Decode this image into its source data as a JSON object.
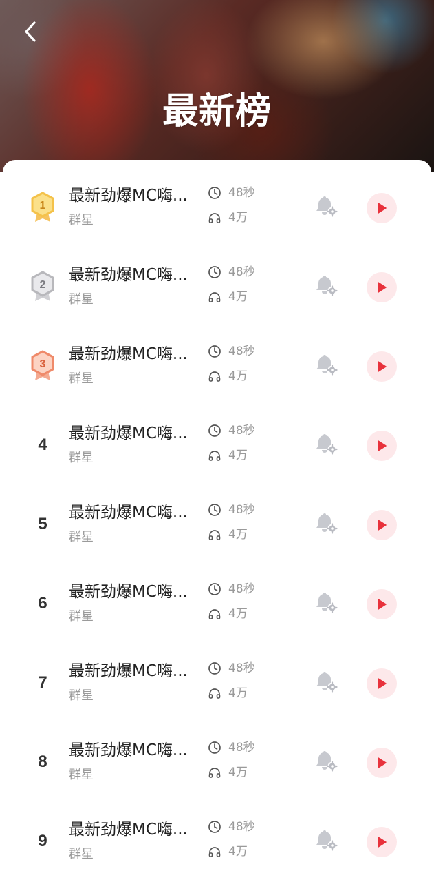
{
  "header": {
    "title": "最新榜",
    "back_icon": "chevron-left-icon"
  },
  "colors": {
    "accent": "#e8323c",
    "play_bg": "#fde8ea",
    "gold": "#f4c24a",
    "silver": "#b8b8bc",
    "bronze": "#ef8a6a"
  },
  "songs": [
    {
      "rank": "1",
      "medal": "gold",
      "title": "最新劲爆MC嗨...",
      "artist": "群星",
      "duration": "48秒",
      "plays": "4万"
    },
    {
      "rank": "2",
      "medal": "silver",
      "title": "最新劲爆MC嗨...",
      "artist": "群星",
      "duration": "48秒",
      "plays": "4万"
    },
    {
      "rank": "3",
      "medal": "bronze",
      "title": "最新劲爆MC嗨...",
      "artist": "群星",
      "duration": "48秒",
      "plays": "4万"
    },
    {
      "rank": "4",
      "medal": "",
      "title": "最新劲爆MC嗨...",
      "artist": "群星",
      "duration": "48秒",
      "plays": "4万"
    },
    {
      "rank": "5",
      "medal": "",
      "title": "最新劲爆MC嗨...",
      "artist": "群星",
      "duration": "48秒",
      "plays": "4万"
    },
    {
      "rank": "6",
      "medal": "",
      "title": "最新劲爆MC嗨...",
      "artist": "群星",
      "duration": "48秒",
      "plays": "4万"
    },
    {
      "rank": "7",
      "medal": "",
      "title": "最新劲爆MC嗨...",
      "artist": "群星",
      "duration": "48秒",
      "plays": "4万"
    },
    {
      "rank": "8",
      "medal": "",
      "title": "最新劲爆MC嗨...",
      "artist": "群星",
      "duration": "48秒",
      "plays": "4万"
    },
    {
      "rank": "9",
      "medal": "",
      "title": "最新劲爆MC嗨...",
      "artist": "群星",
      "duration": "48秒",
      "plays": "4万"
    }
  ]
}
